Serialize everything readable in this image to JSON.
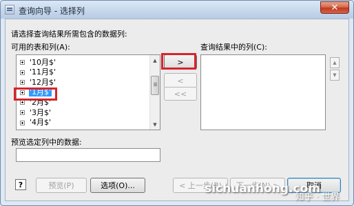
{
  "window": {
    "title": "查询向导 - 选择列",
    "close_glyph": "✕"
  },
  "instructions": "请选择查询结果所需包含的数据列:",
  "available": {
    "label": "可用的表和列(A):",
    "items": [
      {
        "label": "'10月$'",
        "selected": false
      },
      {
        "label": "'11月$'",
        "selected": false
      },
      {
        "label": "'12月$'",
        "selected": false
      },
      {
        "label": "'1月$'",
        "selected": true
      },
      {
        "label": "'2月$'",
        "selected": false
      },
      {
        "label": "'3月$'",
        "selected": false
      },
      {
        "label": "'4月$'",
        "selected": false
      }
    ]
  },
  "selected_columns": {
    "label": "查询结果中的列(C):"
  },
  "move_buttons": {
    "add": ">",
    "remove": "<",
    "remove_all": "<<"
  },
  "order_buttons": {
    "up": "▲",
    "down": "▼"
  },
  "preview": {
    "label": "预览选定列中的数据:",
    "value": ""
  },
  "footer": {
    "help": "?",
    "preview_btn": "预览(P)",
    "options_btn": "选项(O)...",
    "back_btn": "< 上一步(B)",
    "next_btn": "下一步(N) >",
    "cancel_btn": "取消"
  },
  "watermark": {
    "main": "sichuanhong.com",
    "sub": "知乎 · 世界"
  },
  "colors": {
    "selection": "#3399ff",
    "highlight_box": "#d6242c"
  }
}
